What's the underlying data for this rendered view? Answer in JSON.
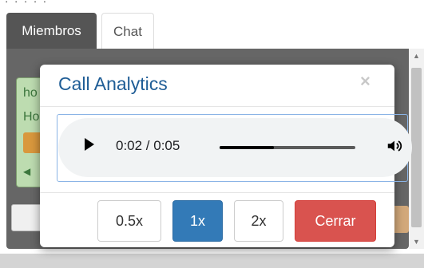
{
  "tabs": {
    "members": "Miembros",
    "chat": "Chat"
  },
  "background": {
    "header_fragment": "· ·   ·  ·  ·",
    "list_items": [
      "ho",
      "Ho"
    ],
    "mic_glyph": "◀"
  },
  "modal": {
    "title": "Call Analytics",
    "close_glyph": "×",
    "player": {
      "current_time": "0:02",
      "duration": "0:05",
      "time_display": "0:02 / 0:05",
      "progress_fraction": 0.4
    },
    "speed_buttons": [
      "0.5x",
      "1x",
      "2x"
    ],
    "active_speed": "1x",
    "close_button": "Cerrar"
  },
  "colors": {
    "primary": "#337ab7",
    "danger": "#d9534f",
    "title": "#1f5d96",
    "tab_active": "#555555"
  },
  "icons": {
    "play": "play-icon",
    "volume": "volume-icon",
    "close": "close-icon",
    "scroll_up": "scroll-up-icon",
    "scroll_down": "scroll-down-icon"
  }
}
